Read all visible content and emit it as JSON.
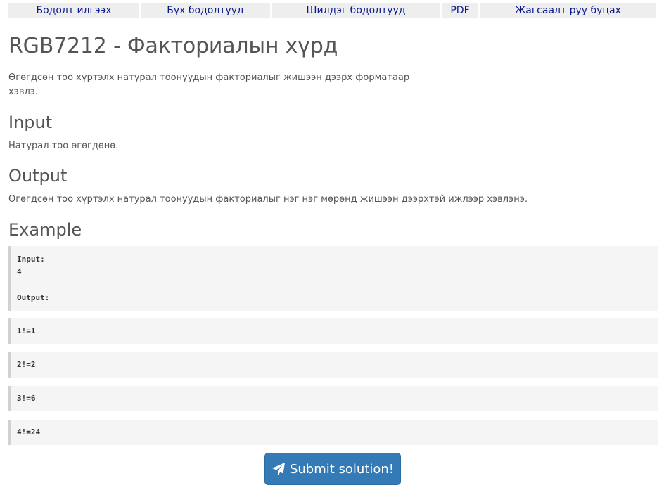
{
  "nav": {
    "items": [
      "Бодолт илгээх",
      "Бүх бодолтууд",
      "Шилдэг бодолтууд",
      "PDF",
      "Жагсаалт руу буцах"
    ]
  },
  "problem": {
    "title": "RGB7212 - Факториалын хүрд",
    "description": "Өгөгдсөн тоо хүртэлх натурал тоонуудын факториалыг жишээн дээрх форматаар хэвлэ.",
    "input_heading": "Input",
    "input_text": "Натурал тоо өгөгдөнө.",
    "output_heading": "Output",
    "output_text": "Өгөгдсөн тоо хүртэлх натурал тоонуудын факториалыг нэг нэг мөрөнд жишээн дээрхтэй ижлээр хэвлэнэ.",
    "example_heading": "Example"
  },
  "example": {
    "input_label": "Input:",
    "input_value": "4",
    "output_label": "Output:",
    "output_lines": [
      "1!=1",
      "2!=2",
      "3!=6",
      "4!=24"
    ]
  },
  "submit": {
    "label": "Submit solution!",
    "icon": "paper-plane-icon"
  },
  "colors": {
    "nav_bg": "#eeeeee",
    "nav_link": "#0a1a8a",
    "button": "#337ab7",
    "pre_bg": "#f5f5f5"
  }
}
